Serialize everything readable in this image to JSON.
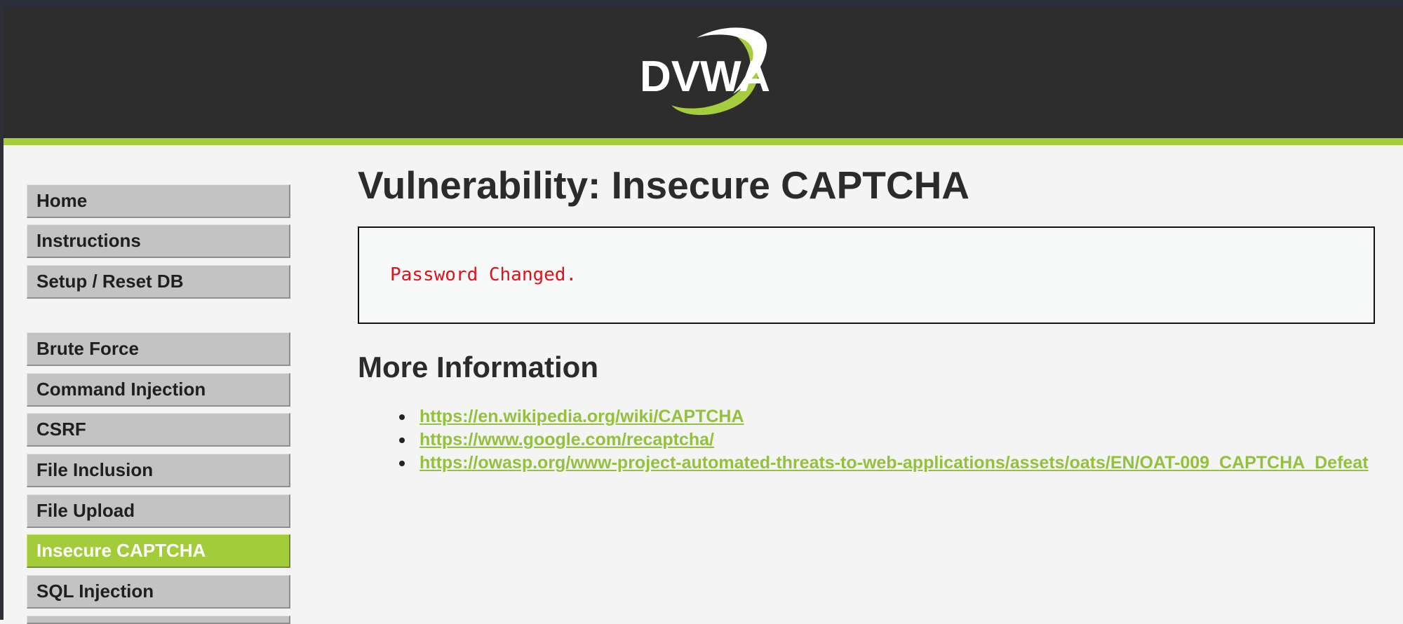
{
  "header": {
    "logo_text": "DVWA"
  },
  "sidebar": {
    "items": [
      {
        "label": "Home",
        "selected": false
      },
      {
        "label": "Instructions",
        "selected": false
      },
      {
        "label": "Setup / Reset DB",
        "selected": false
      },
      {
        "label": "Brute Force",
        "selected": false
      },
      {
        "label": "Command Injection",
        "selected": false
      },
      {
        "label": "CSRF",
        "selected": false
      },
      {
        "label": "File Inclusion",
        "selected": false
      },
      {
        "label": "File Upload",
        "selected": false
      },
      {
        "label": "Insecure CAPTCHA",
        "selected": true
      },
      {
        "label": "SQL Injection",
        "selected": false
      }
    ]
  },
  "main": {
    "title": "Vulnerability: Insecure CAPTCHA",
    "result_message": "Password Changed.",
    "more_info_title": "More Information",
    "links": [
      {
        "text": "https://en.wikipedia.org/wiki/CAPTCHA"
      },
      {
        "text": "https://www.google.com/recaptcha/"
      },
      {
        "text": "https://owasp.org/www-project-automated-threats-to-web-applications/assets/oats/EN/OAT-009_CAPTCHA_Defeat"
      }
    ]
  },
  "colors": {
    "header_bg": "#2d2d2d",
    "accent_green": "#a6cd3b",
    "menu_bg": "#c3c3c3",
    "error_red": "#e1111b",
    "link_green": "#94c13d"
  }
}
